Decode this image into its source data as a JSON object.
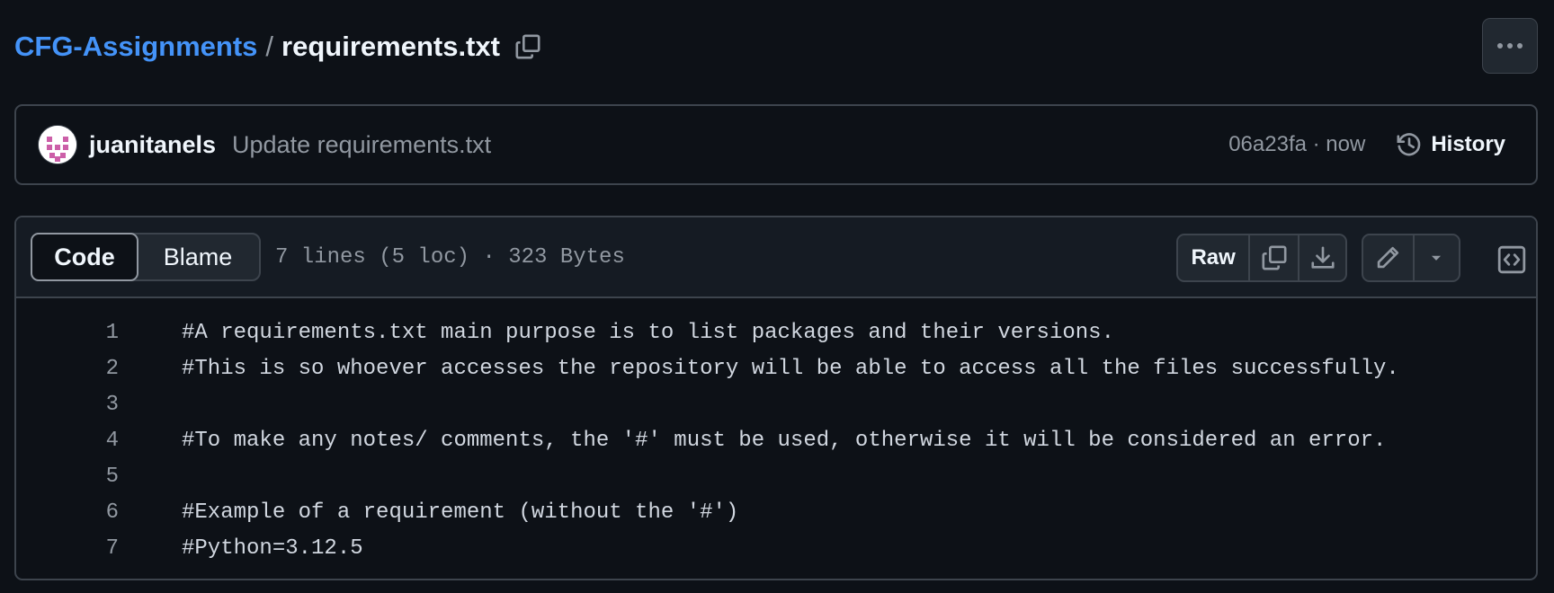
{
  "breadcrumb": {
    "repo": "CFG-Assignments",
    "separator": "/",
    "file": "requirements.txt"
  },
  "commit": {
    "author": "juanitanels",
    "message": "Update requirements.txt",
    "meta": "06a23fa · now",
    "history_label": "History"
  },
  "file_view": {
    "tabs": {
      "code": "Code",
      "blame": "Blame"
    },
    "info": "7 lines (5 loc) · 323 Bytes",
    "raw_label": "Raw"
  },
  "lines": [
    {
      "number": "1",
      "text": "#A requirements.txt main purpose is to list packages and their versions."
    },
    {
      "number": "2",
      "text": "#This is so whoever accesses the repository will be able to access all the files successfully."
    },
    {
      "number": "3",
      "text": ""
    },
    {
      "number": "4",
      "text": "#To make any notes/ comments, the '#' must be used, otherwise it will be considered an error."
    },
    {
      "number": "5",
      "text": ""
    },
    {
      "number": "6",
      "text": "#Example of a requirement (without the '#')"
    },
    {
      "number": "7",
      "text": "#Python=3.12.5"
    }
  ],
  "icons": {
    "copy_path": "copy-icon",
    "more": "kebab-horizontal-icon",
    "history": "history-icon",
    "copy_raw": "copy-icon",
    "download": "download-icon",
    "edit": "pencil-icon",
    "dropdown": "triangle-down-icon",
    "symbols": "code-square-icon"
  },
  "colors": {
    "background": "#0d1117",
    "link": "#4493f8",
    "muted": "#9198a1",
    "border": "#3d444d"
  }
}
